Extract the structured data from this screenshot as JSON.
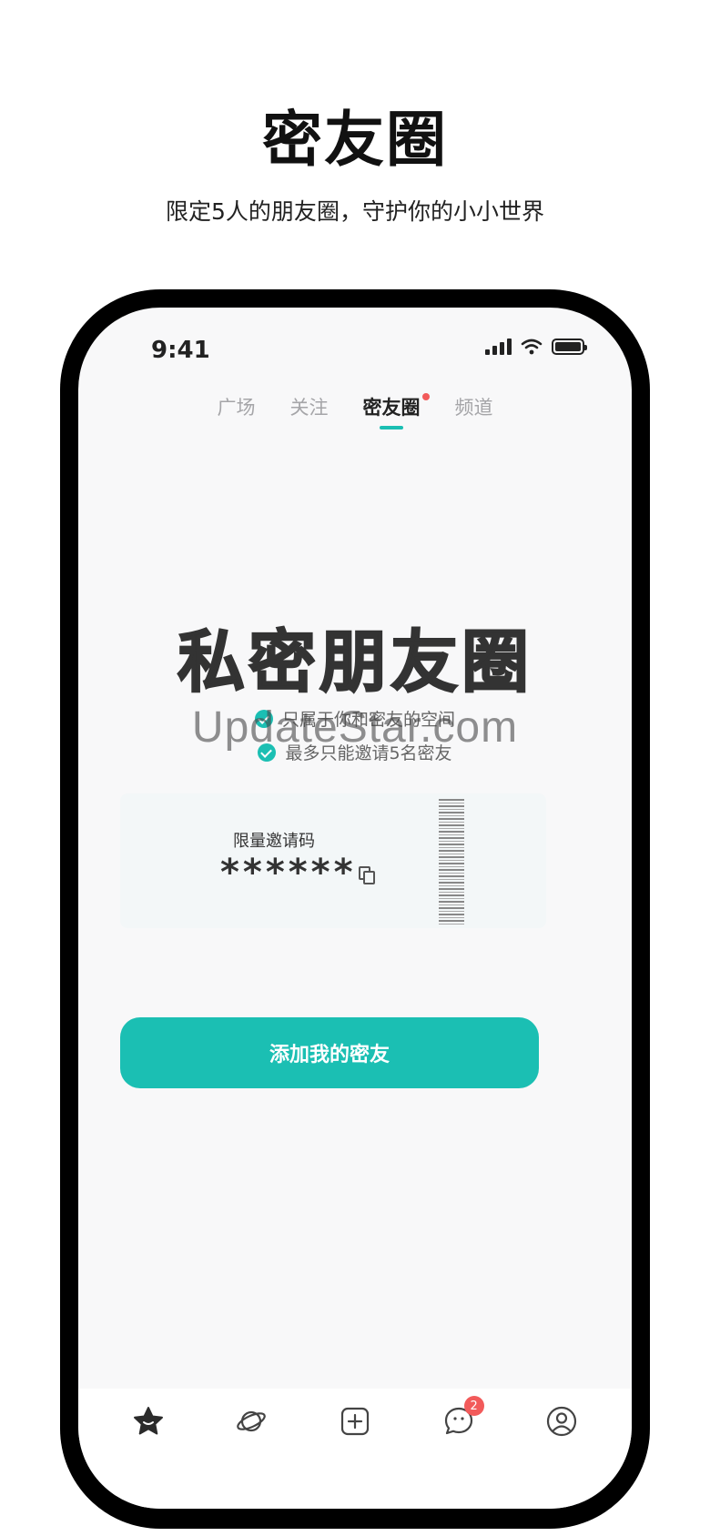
{
  "headline": "密友圈",
  "subline": "限定5人的朋友圈，守护你的小小世界",
  "status_bar": {
    "time": "9:41"
  },
  "tabs": [
    {
      "label": "广场",
      "active": false
    },
    {
      "label": "关注",
      "active": false
    },
    {
      "label": "密友圈",
      "active": true
    },
    {
      "label": "频道",
      "active": false
    }
  ],
  "hero_title": "私密朋友圈",
  "features": [
    {
      "text": "只属于你和密友的空间"
    },
    {
      "text": "最多只能邀请5名密友"
    }
  ],
  "watermark": "UpdateStar.com",
  "invite": {
    "label": "限量邀请码",
    "code": "******"
  },
  "cta_label": "添加我的密友",
  "bottom_nav": {
    "items": [
      {
        "icon": "star-icon",
        "active": true
      },
      {
        "icon": "planet-icon",
        "active": false
      },
      {
        "icon": "add-square-icon",
        "active": false
      },
      {
        "icon": "chat-bubble-icon",
        "active": false,
        "badge": "2"
      },
      {
        "icon": "profile-icon",
        "active": false
      }
    ]
  },
  "colors": {
    "accent": "#1bbfb3",
    "badge": "#f25a5a",
    "screen_bg": "#f8f8f9"
  }
}
